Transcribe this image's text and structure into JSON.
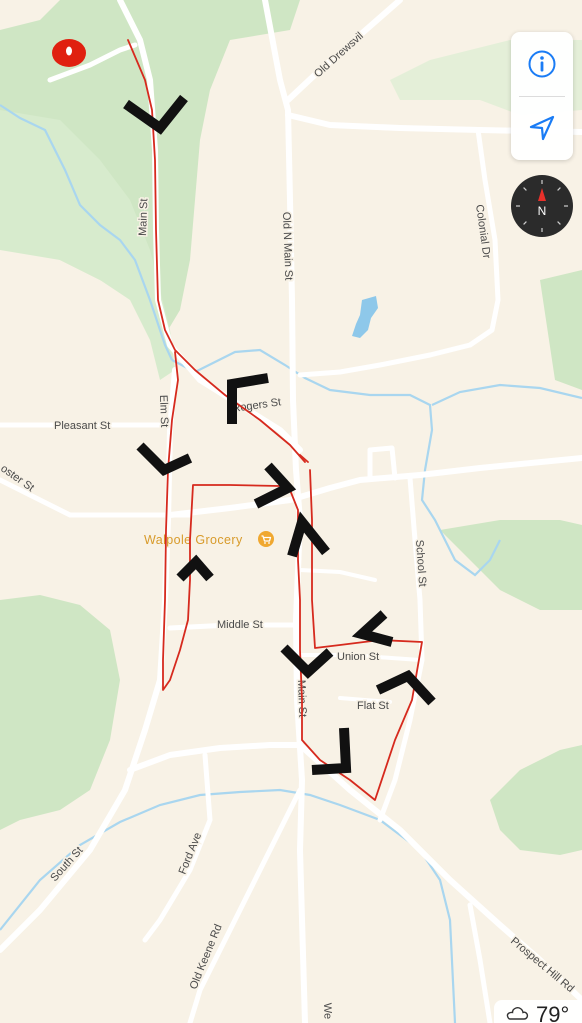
{
  "map": {
    "streets": {
      "old_drewsville": "Old Drewsvil",
      "colonial_dr": "Colonial Dr",
      "old_n_main_st": "Old N Main St",
      "main_st_north": "Main St",
      "rogers_st": "Rogers St",
      "elm_st": "Elm St",
      "pleasant_st": "Pleasant St",
      "foster_st": "oster St",
      "school_st": "School St",
      "middle_st": "Middle St",
      "union_st": "Union St",
      "main_st_south": "Main St",
      "flat_st": "Flat St",
      "south_st": "South St",
      "ford_ave": "Ford Ave",
      "old_keene_rd": "Old Keene Rd",
      "prospect_hill_rd": "Prospect Hill Rd",
      "we_st": "We"
    },
    "poi": {
      "name": "Walpole Grocery",
      "icon": "cart-icon",
      "color": "#f0a830"
    },
    "annotations": {
      "route_color": "#d62a1e",
      "check_color": "#111111",
      "start_marker_color": "#e02010"
    }
  },
  "controls": {
    "info_icon": "info-icon",
    "location_icon": "location-arrow-icon",
    "compass_label": "N",
    "accent_color": "#1a7cf5"
  },
  "weather": {
    "icon": "cloud-icon",
    "temperature": "79°"
  }
}
